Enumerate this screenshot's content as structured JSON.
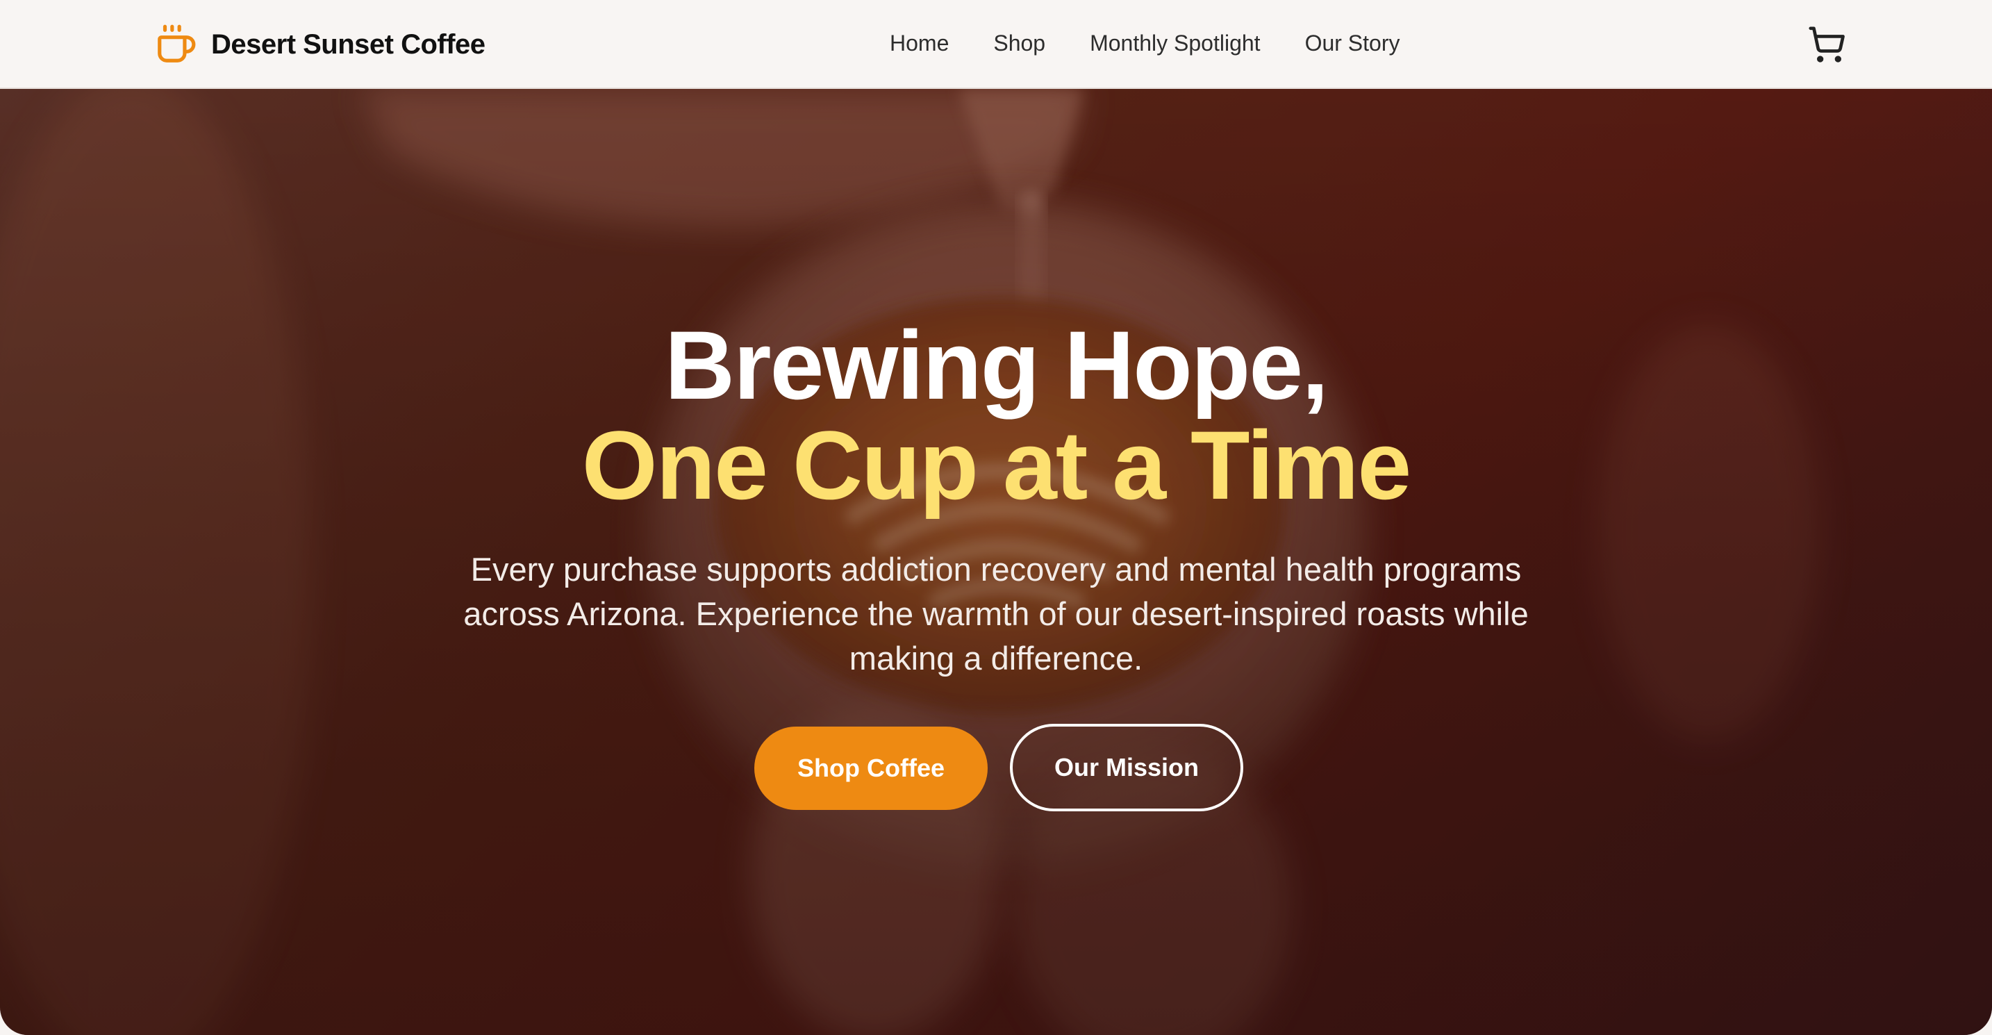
{
  "brand": {
    "name": "Desert Sunset Coffee",
    "icon": "coffee-cup-icon",
    "accent_color": "#ee8a12"
  },
  "nav": {
    "links": [
      "Home",
      "Shop",
      "Monthly Spotlight",
      "Our Story"
    ],
    "cart_icon": "cart-icon"
  },
  "hero": {
    "headline_line1": "Brewing Hope,",
    "headline_line2": "One Cup at a Time",
    "headline_line2_color": "#fde071",
    "subtext": "Every purchase supports addiction recovery and mental health programs across Arizona. Experience the warmth of our desert-inspired roasts while making a difference.",
    "primary_button": "Shop Coffee",
    "secondary_button": "Our Mission",
    "primary_color": "#ee8a12"
  }
}
